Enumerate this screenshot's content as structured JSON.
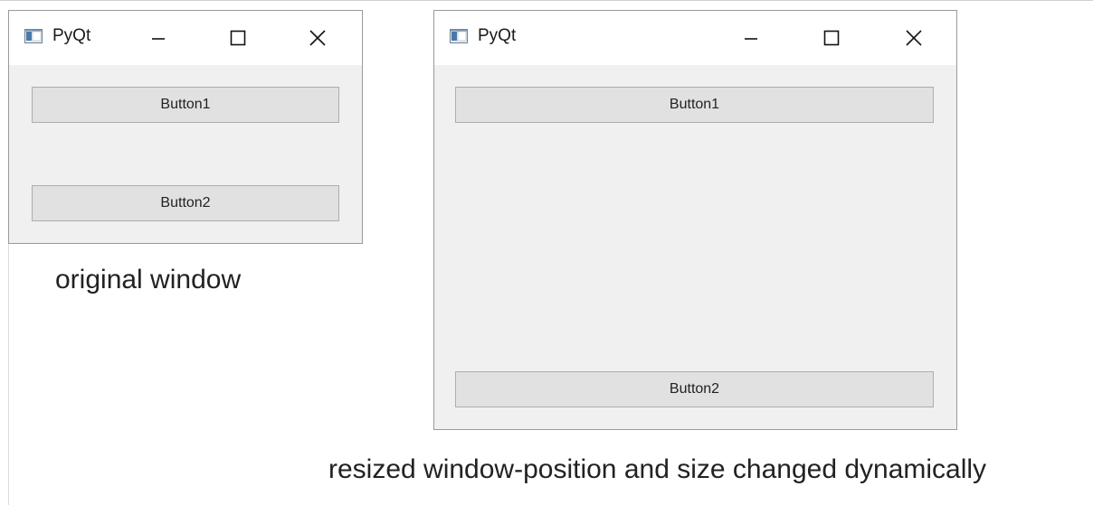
{
  "windows": [
    {
      "title": "PyQt",
      "buttons": [
        "Button1",
        "Button2"
      ]
    },
    {
      "title": "PyQt",
      "buttons": [
        "Button1",
        "Button2"
      ]
    }
  ],
  "captions": {
    "original": "original window",
    "resized": "resized window-position and size changed dynamically"
  },
  "icons": {
    "app": "app-window-icon",
    "minimize": "minimize-icon",
    "maximize": "maximize-icon",
    "close": "close-icon"
  },
  "colors": {
    "window_bg": "#f0f0f0",
    "titlebar_bg": "#ffffff",
    "button_bg": "#e1e1e1",
    "button_border": "#adadad"
  }
}
